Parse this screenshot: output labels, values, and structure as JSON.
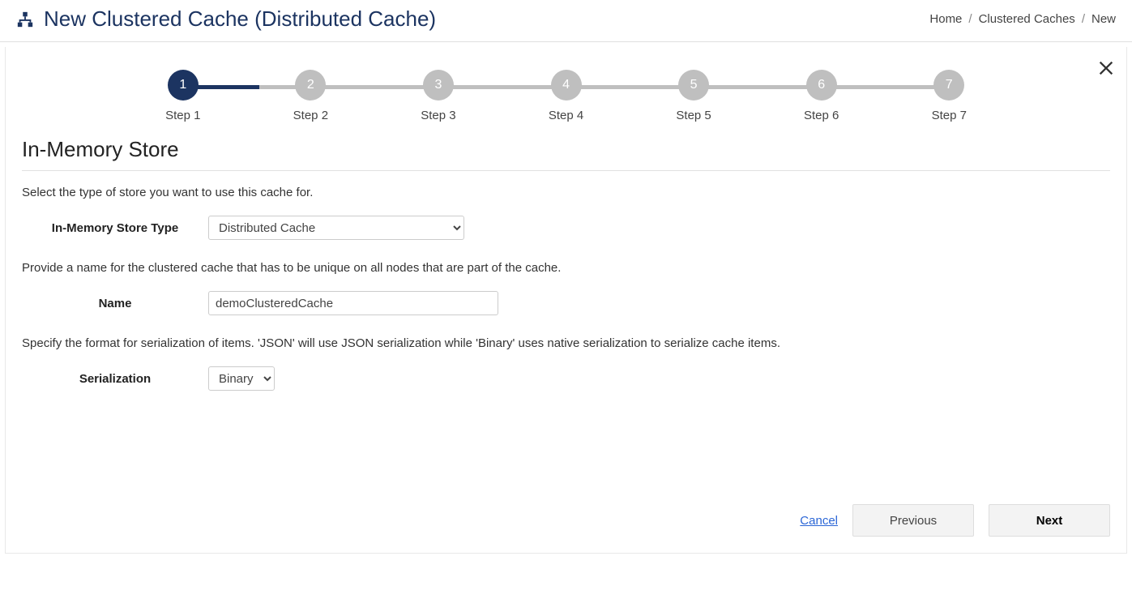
{
  "header": {
    "title": "New Clustered Cache (Distributed Cache)",
    "breadcrumb": [
      "Home",
      "Clustered Caches",
      "New"
    ]
  },
  "stepper": {
    "steps": [
      {
        "num": "1",
        "label": "Step 1",
        "active": true
      },
      {
        "num": "2",
        "label": "Step 2",
        "active": false
      },
      {
        "num": "3",
        "label": "Step 3",
        "active": false
      },
      {
        "num": "4",
        "label": "Step 4",
        "active": false
      },
      {
        "num": "5",
        "label": "Step 5",
        "active": false
      },
      {
        "num": "6",
        "label": "Step 6",
        "active": false
      },
      {
        "num": "7",
        "label": "Step 7",
        "active": false
      }
    ]
  },
  "section": {
    "title": "In-Memory Store",
    "help1": "Select the type of store you want to use this cache for.",
    "storeTypeLabel": "In-Memory Store Type",
    "storeTypeValue": "Distributed Cache",
    "help2": "Provide a name for the clustered cache that has to be unique on all nodes that are part of the cache.",
    "nameLabel": "Name",
    "nameValue": "demoClusteredCache",
    "help3": "Specify the format for serialization of items. 'JSON' will use JSON serialization while 'Binary' uses native serialization to serialize cache items.",
    "serializationLabel": "Serialization",
    "serializationValue": "Binary"
  },
  "footer": {
    "cancel": "Cancel",
    "previous": "Previous",
    "next": "Next"
  }
}
